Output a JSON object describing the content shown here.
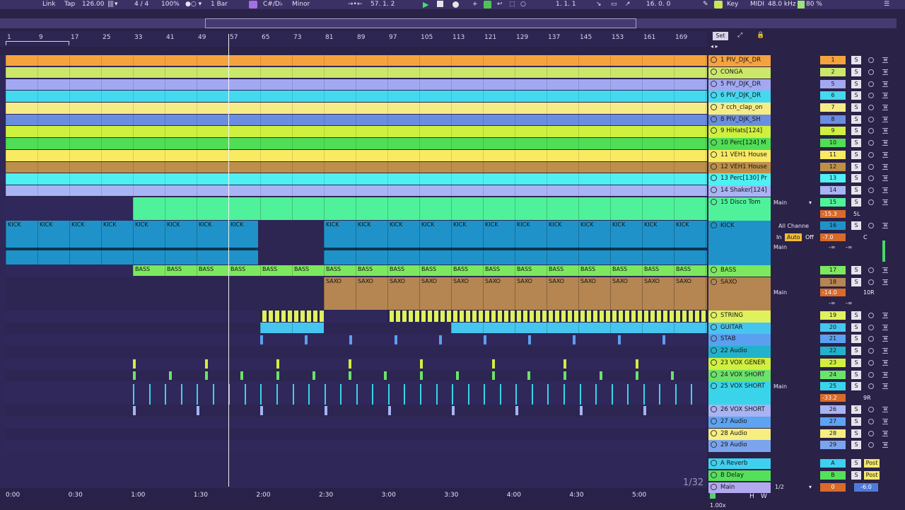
{
  "transport": {
    "link": "Link",
    "tap": "Tap",
    "tempo": "126.00",
    "signature": "4 / 4",
    "zoom": "100%",
    "quantize": "1 Bar",
    "key": "C#/D♭",
    "scale": "Minor",
    "position": "57.  1.  2",
    "loop_start": "1.  1.  1",
    "loop_length": "16.  0.  0",
    "key_label": "Key",
    "midi_label": "MIDI",
    "sample_rate": "48.0 kHz",
    "cpu": "80 %"
  },
  "ruler_bars": [
    "1",
    "9",
    "17",
    "25",
    "33",
    "41",
    "49",
    "57",
    "65",
    "73",
    "81",
    "89",
    "97",
    "105",
    "113",
    "121",
    "129",
    "137",
    "145",
    "153",
    "161",
    "169"
  ],
  "set_button": "Set",
  "tracks": [
    {
      "name": "1 PIV_DJK_DR",
      "color": "#f4a33e",
      "num": "1"
    },
    {
      "name": "CONGA",
      "color": "#cbe86a",
      "num": "2"
    },
    {
      "name": "5 PIV_DJK_DR",
      "color": "#a3a8f2",
      "num": "5"
    },
    {
      "name": "6 PIV_DJK_DR",
      "color": "#43d9ef",
      "num": "6"
    },
    {
      "name": "7 cch_clap_on",
      "color": "#f6ec86",
      "num": "7"
    },
    {
      "name": "8 PIV_DJK_SH",
      "color": "#6a8de0",
      "num": "8"
    },
    {
      "name": "9 HiHats[124]",
      "color": "#cff03f",
      "num": "9"
    },
    {
      "name": "10 Perc[124] M",
      "color": "#4fde55",
      "num": "10"
    },
    {
      "name": "11 VEH1 House",
      "color": "#f8ea63",
      "num": "11"
    },
    {
      "name": "12 VEH1 House",
      "color": "#bc8f4a",
      "num": "12"
    },
    {
      "name": "13 Perc[130] Pr",
      "color": "#4ff0f2",
      "num": "13"
    },
    {
      "name": "14 Shaker[124]",
      "color": "#a9b4f4",
      "num": "14"
    },
    {
      "name": "15 Disco Tom",
      "color": "#4ff29a",
      "num": "15"
    },
    {
      "name": "KICK",
      "color": "#1f93c9",
      "num": "16"
    },
    {
      "name": "BASS",
      "color": "#7de85e",
      "num": "17"
    },
    {
      "name": "SAXO",
      "color": "#b58651",
      "num": "18"
    },
    {
      "name": "STRING",
      "color": "#dff25e",
      "num": "19"
    },
    {
      "name": "GUITAR",
      "color": "#46c6ef",
      "num": "20"
    },
    {
      "name": "STAB",
      "color": "#5ba0f0",
      "num": "21"
    },
    {
      "name": "22 Audio",
      "color": "#23b2cc",
      "num": "22"
    },
    {
      "name": "23 VOX GENER",
      "color": "#d0ef3f",
      "num": "23"
    },
    {
      "name": "24 VOX SHORT",
      "color": "#6be26b",
      "num": "24"
    },
    {
      "name": "25 VOX SHORT",
      "color": "#39d4ea",
      "num": "25"
    },
    {
      "name": "26 VOX SHORT",
      "color": "#a8b3f3",
      "num": "26"
    },
    {
      "name": "27 Audio",
      "color": "#5ea3f2",
      "num": "27"
    },
    {
      "name": "28 Audio",
      "color": "#f6ee80",
      "num": "28"
    },
    {
      "name": "29 Audio",
      "color": "#7ba4ee",
      "num": "29"
    }
  ],
  "returns": [
    {
      "name": "A Reverb",
      "color": "#3fd0f0",
      "num": "A",
      "post": "Post"
    },
    {
      "name": "B Delay",
      "color": "#55e05b",
      "num": "B",
      "post": "Post"
    }
  ],
  "master": {
    "name": "Main",
    "color": "#b2a8f0",
    "route": "1/2",
    "vol": "0",
    "pan": "-6.0"
  },
  "mixer_controls": {
    "out_main": "Main",
    "vol_15": "-15.3",
    "pan_15": "5L",
    "all_channels": "All Channe",
    "in": "In",
    "auto": "Auto",
    "off": "Off",
    "vol_16": "-7.0",
    "pan_16": "C",
    "inf": "-∞",
    "vol_18": "-14.0",
    "pan_18": "10R",
    "vol_25": "-33.2",
    "pan_25": "9R"
  },
  "solo_label": "S",
  "clip_labels": {
    "kick": "KICK",
    "bass": "BASS",
    "saxo": "SAXO"
  },
  "timeline": [
    "0:00",
    "0:30",
    "1:00",
    "1:30",
    "2:00",
    "2:30",
    "3:00",
    "3:30",
    "4:00",
    "4:30",
    "5:00"
  ],
  "page_indicator": "1/32",
  "zoom_footer": "1.00x",
  "footer_h": "H",
  "footer_w": "W"
}
